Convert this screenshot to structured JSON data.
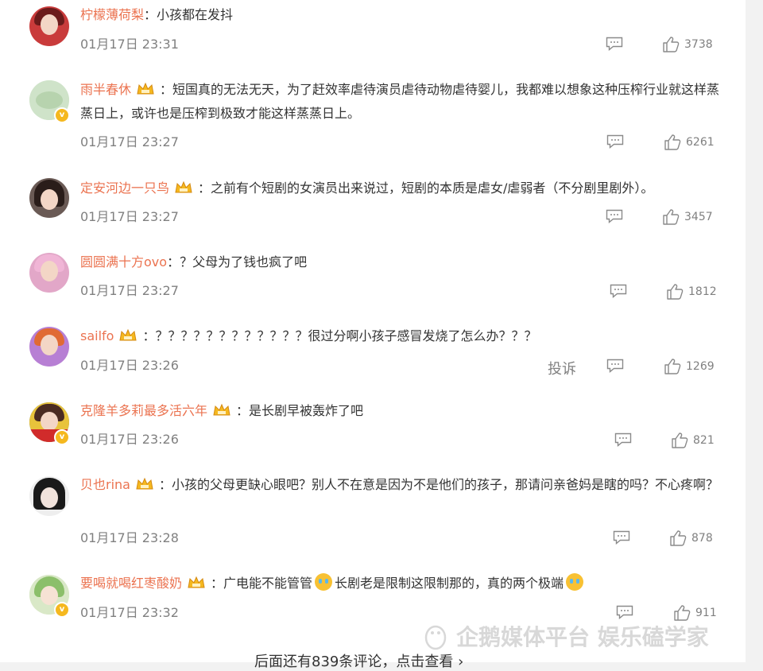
{
  "comments": [
    {
      "username": "柠檬薄荷梨",
      "has_crown": false,
      "verified": false,
      "text": "：小孩都在发抖",
      "time": "01月17日 23:31",
      "likes": "3738",
      "avatar_color": "#c93b3b",
      "hair_color": "#6b1b1b"
    },
    {
      "username": "雨半春休",
      "has_crown": true,
      "verified": true,
      "text": "：短国真的无法无天，为了赶效率虐待演员虐待动物虐待婴儿，我都难以想象这种压榨行业就这样蒸蒸日上，或许也是压榨到极致才能这样蒸蒸日上。",
      "time": "01月17日 23:27",
      "likes": "6261",
      "avatar_color": "#cfe3c9",
      "hair_color": "#a9c8a2"
    },
    {
      "username": "定安河边一只鸟",
      "has_crown": true,
      "verified": false,
      "text": "：之前有个短剧的女演员出来说过，短剧的本质是虐女/虐弱者（不分剧里剧外）。",
      "time": "01月17日 23:27",
      "likes": "3457",
      "avatar_color": "#6a5a55",
      "hair_color": "#2a1d1a"
    },
    {
      "username": "圆圆满十方ovo",
      "has_crown": false,
      "verified": false,
      "text": "：？父母为了钱也疯了吧",
      "time": "01月17日 23:27",
      "likes": "1812",
      "avatar_color": "#e2a7c8",
      "hair_color": "#f0b5d6"
    },
    {
      "username": "sailfo",
      "has_crown": true,
      "verified": false,
      "text": "：？？？？？？？？？？？？很过分啊小孩子感冒发烧了怎么办？？？",
      "time": "01月17日 23:26",
      "likes": "1269",
      "avatar_color": "#b77fd4",
      "hair_color": "#e06a34"
    },
    {
      "username": "克隆羊多莉最多活六年",
      "has_crown": true,
      "verified": true,
      "text": "：是长剧早被轰炸了吧",
      "time": "01月17日 23:26",
      "likes": "821",
      "avatar_color": "#3b6dc7",
      "hair_color": "#4a2b22"
    },
    {
      "username": "贝也rina",
      "has_crown": true,
      "verified": false,
      "text": "：小孩的父母更缺心眼吧？别人不在意是因为不是他们的孩子，那请问亲爸妈是瞎的吗？不心疼啊？",
      "time": "01月17日 23:28",
      "likes": "878",
      "avatar_color": "#e8e8e8",
      "hair_color": "#1a1a1a"
    },
    {
      "username": "要喝就喝红枣酸奶",
      "has_crown": true,
      "verified": true,
      "text_a": "：广电能不能管管",
      "text_b": "长剧老是限制这限制那的，真的两个极端",
      "time": "01月17日 23:32",
      "likes": "911",
      "avatar_color": "#d9e8c7",
      "hair_color": "#8bbf6a"
    }
  ],
  "report_label": "投诉",
  "more_label": "后面还有839条评论，点击查看 ›",
  "watermark": "企鹅媒体平台 娱乐磕学家",
  "icons": {
    "comment": "comment-icon",
    "like": "thumbs-up-icon",
    "crown": "crown-badge-icon",
    "verified": "verified-badge-icon",
    "emoji": "crying-emoji-icon"
  },
  "colors": {
    "username": "#eb7350",
    "text": "#333333",
    "meta": "#808080"
  }
}
